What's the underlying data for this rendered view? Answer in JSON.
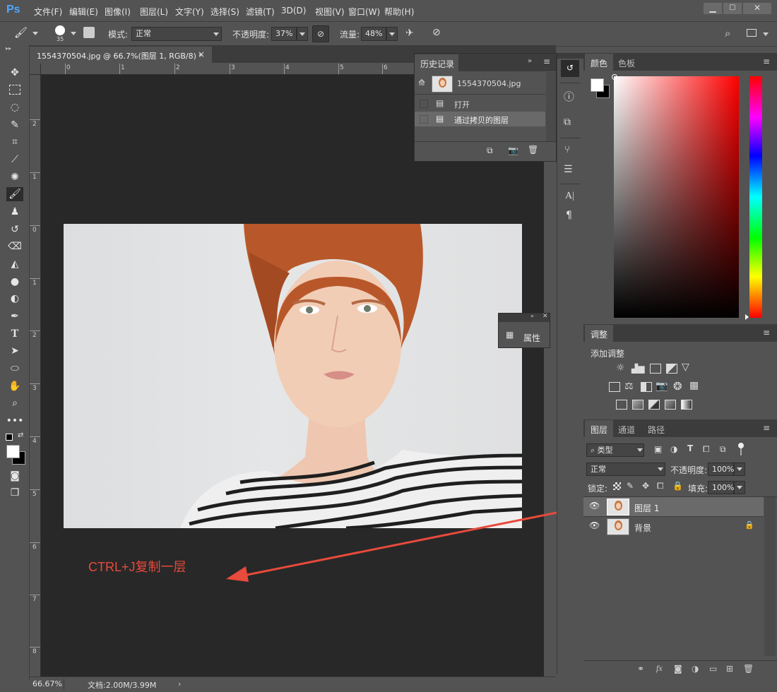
{
  "app": {
    "logo": "Ps"
  },
  "menu": [
    "文件(F)",
    "编辑(E)",
    "图像(I)",
    "图层(L)",
    "文字(Y)",
    "选择(S)",
    "滤镜(T)",
    "3D(D)",
    "视图(V)",
    "窗口(W)",
    "帮助(H)"
  ],
  "options_bar": {
    "brush_size": "35",
    "mode_label": "模式:",
    "mode_value": "正常",
    "opacity_label": "不透明度:",
    "opacity_value": "37%",
    "flow_label": "流量:",
    "flow_value": "48%"
  },
  "document_tab": {
    "title": "1554370504.jpg @ 66.7%(图层 1, RGB/8) *",
    "close": "×"
  },
  "ruler": {
    "top": [
      "0",
      "1",
      "2",
      "3",
      "4",
      "5",
      "6"
    ],
    "left": [
      "2",
      "1",
      "0",
      "1",
      "2",
      "3",
      "4",
      "5",
      "6",
      "7",
      "8"
    ]
  },
  "history_panel": {
    "title": "历史记录",
    "snapshot_name": "1554370504.jpg",
    "items": [
      "打开",
      "通过拷贝的图层"
    ]
  },
  "properties_panel": {
    "label": "属性"
  },
  "color_panel": {
    "tabs": [
      "颜色",
      "色板"
    ]
  },
  "adjustments_panel": {
    "tab": "调整",
    "add_label": "添加调整"
  },
  "layers_panel": {
    "tabs": [
      "图层",
      "通道",
      "路径"
    ],
    "filter_kind": "类型",
    "blend_mode": "正常",
    "opacity_label": "不透明度:",
    "opacity_value": "100%",
    "lock_label": "锁定:",
    "fill_label": "填充:",
    "fill_value": "100%",
    "layers": [
      {
        "name": "图层 1",
        "selected": true,
        "locked": false
      },
      {
        "name": "背景",
        "selected": false,
        "locked": true
      }
    ]
  },
  "status_bar": {
    "zoom": "66.67%",
    "doc_info": "文档:2.00M/3.99M"
  },
  "annotation": {
    "text": "CTRL+J复制一层",
    "color": "#e84a3c"
  }
}
